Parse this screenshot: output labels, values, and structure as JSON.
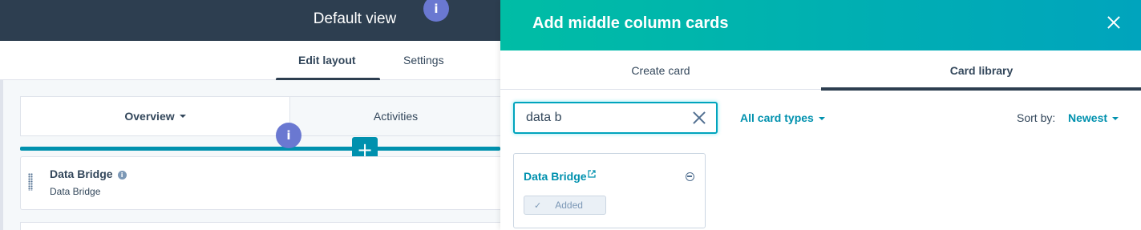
{
  "editor": {
    "view_title": "Default view",
    "tabs": {
      "edit_layout": "Edit layout",
      "settings": "Settings"
    },
    "column_tabs": {
      "overview": "Overview",
      "activities": "Activities"
    },
    "info_badge": "i",
    "add_button": "+",
    "card": {
      "title": "Data Bridge",
      "subtitle": "Data Bridge"
    }
  },
  "panel": {
    "title": "Add middle column cards",
    "tabs": {
      "create_card": "Create card",
      "card_library": "Card library"
    },
    "search": {
      "value": "data b"
    },
    "filter": {
      "label": "All card types"
    },
    "sort": {
      "label": "Sort by:",
      "value": "Newest"
    },
    "results": [
      {
        "title": "Data Bridge",
        "status_label": "Added",
        "status_icon": "check-icon"
      }
    ]
  },
  "colors": {
    "header_dark": "#2d3e50",
    "accent_teal": "#0091ae",
    "header_gradient_start": "#00bda5",
    "header_gradient_end": "#00a4bd",
    "info_purple": "#6a78d1"
  }
}
